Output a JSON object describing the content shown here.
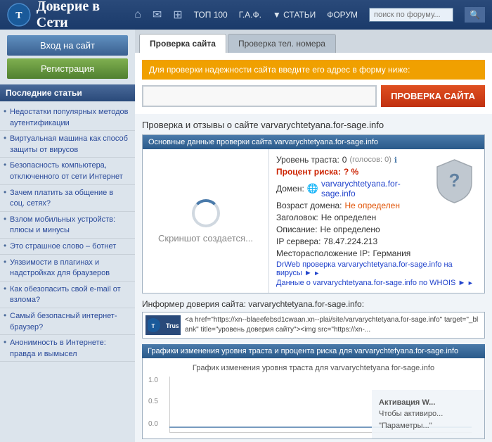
{
  "header": {
    "title": "Доверие в Сети",
    "nav": {
      "home_icon": "⌂",
      "email_icon": "✉",
      "grid_icon": "⊞",
      "top100": "ТОП 100",
      "faq": "Г.А.Ф.",
      "articles": "▼ СТАТЬИ",
      "forum": "ФОРУМ",
      "search_placeholder": "поиск по форуму...",
      "search_btn": "🔍"
    }
  },
  "sidebar": {
    "login_btn": "Вход на сайт",
    "register_btn": "Регистрация",
    "articles_title": "Последние статьи",
    "articles": [
      "Недостатки популярных методов аутентификации",
      "Виртуальная машина как способ защиты от вирусов",
      "Безопасность компьютера, отключенного от сети Интернет",
      "Зачем платить за общение в соц. сетях?",
      "Взлом мобильных устройств: плюсы и минусы",
      "Это страшное слово – ботнет",
      "Уязвимости в плагинах и надстройках для браузеров",
      "Как обезопасить свой e-mail от взлома?",
      "Самый безопасный интернет-браузер?",
      "Анонимность в Интернете: правда и вымысел"
    ]
  },
  "tabs": {
    "tab1": "Проверка сайта",
    "tab2": "Проверка тел. номера"
  },
  "check": {
    "prompt": "Для проверки надежности сайта введите его адрес в форму ниже:",
    "input_value": "",
    "input_placeholder": "",
    "button_label": "ПРОВЕРКА САЙТА"
  },
  "results": {
    "title": "Проверка и отзывы о сайте varvarychtetyana.for-sage.info",
    "data_header": "Основные данные проверки сайта varvarychtetyana.for-sage.info",
    "screenshot_text": "Скриншот создается...",
    "trust_level_label": "Уровень траста:",
    "trust_level_value": "0",
    "trust_votes": "(голосов: 0)",
    "percent_label": "Процент риска:",
    "percent_value": "? %",
    "domain_label": "Домен:",
    "domain_value": "varvarychtetyana.for-sage.info",
    "age_label": "Возраст домена:",
    "age_value": "Не определен",
    "header_label": "Заголовок:",
    "header_value": "Не определен",
    "desc_label": "Описание:",
    "desc_value": "Не определено",
    "ip_label": "IP сервера:",
    "ip_value": "78.47.224.213",
    "location_label": "Месторасположение IP:",
    "location_value": "Германия",
    "drweb_link": "DrWeb проверка varvarychtetyana.for-sage.info на вирусы ►",
    "whois_link": "Данные о varvarychtetyana.for-sage.info по WHOIS ►"
  },
  "informer": {
    "title": "Информер доверия сайта: varvarychtetyana.for-sage.info:",
    "logo_text": "Trust",
    "code": "<a href=\"https://xn--blaeefebsd1cwaan.xn--plai/site/varvarychtetyana.for-sage.info\" target=\"_blank\" title=\"уровень доверия сайту\"><img src=\"https://xn-..."
  },
  "graph": {
    "header": "Графики изменения уровня траста и процента риска для varvarychtefyana.for-sage.info",
    "inner_title": "График изменения уровня траста для varvarychtetyana for-sage.info",
    "y_labels": [
      "1.0",
      "0.5",
      "0.0"
    ],
    "y_positions": [
      0,
      35,
      70
    ]
  },
  "windows_activation": {
    "title": "Активация W...",
    "text1": "Чтобы активиро...",
    "text2": "\"Параметры...\""
  }
}
